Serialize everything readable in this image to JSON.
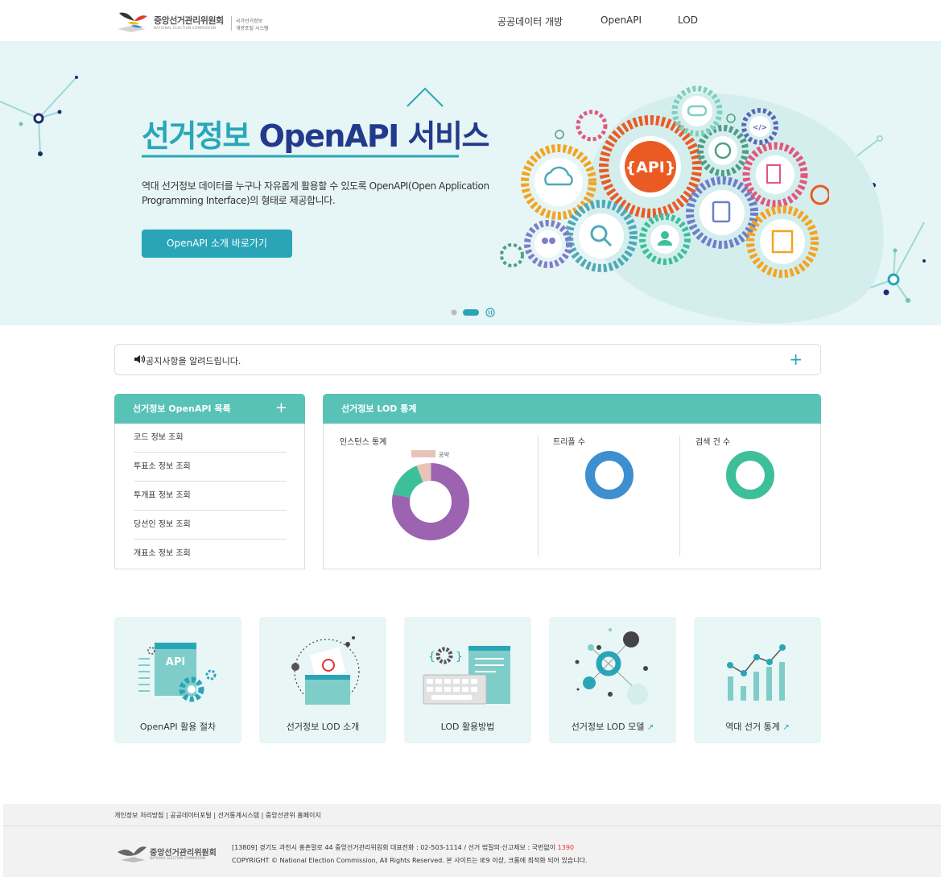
{
  "header": {
    "org_name_kr": "중앙선거관리위원회",
    "org_name_en": "NATIONAL ELECTION COMMISSION",
    "portal_line1": "국가선거정보",
    "portal_line2": "개방포털 시스템",
    "nav": [
      {
        "label": "공공데이터 개방"
      },
      {
        "label": "OpenAPI"
      },
      {
        "label": "LOD"
      }
    ]
  },
  "hero": {
    "title_part1": "선거정보 ",
    "title_part2": "OpenAPI",
    "title_part3": " 서비스",
    "description": "역대 선거정보 데이터를 누구나 자유롭게 활용할 수 있도록 OpenAPI(Open Application Programming Interface)의 형태로 제공합니다.",
    "button_label": "OpenAPI 소개 바로가기",
    "api_badge": "{API}",
    "slides_total": 2,
    "slides_active": 2
  },
  "notice": {
    "text": "공지사항을 알려드립니다.",
    "plus": "+"
  },
  "api_list": {
    "title": "선거정보 OpenAPI 목록",
    "plus": "+",
    "items": [
      {
        "label": "코드 정보 조회"
      },
      {
        "label": "투표소 정보 조회"
      },
      {
        "label": "투개표 정보 조회"
      },
      {
        "label": "당선인 정보 조회"
      },
      {
        "label": "개표소 정보 조회"
      }
    ]
  },
  "lod_stats": {
    "title": "선거정보 LOD 통계",
    "instance_label": "인스턴스 통계",
    "triple_label": "트리플 수",
    "search_label": "검색 건 수",
    "legend_label": "공약"
  },
  "chart_data": [
    {
      "type": "pie",
      "donut": true,
      "title": "인스턴스 통계",
      "slices": [
        {
          "name": "",
          "value": 0.78,
          "color": "#9b63b0"
        },
        {
          "name": "",
          "value": 0.16,
          "color": "#3dbf9a"
        },
        {
          "name": "공약",
          "value": 0.06,
          "color": "#e8c3b8"
        }
      ],
      "legend": [
        "공약"
      ]
    },
    {
      "type": "pie",
      "donut": true,
      "title": "트리플 수",
      "slices": [
        {
          "name": "",
          "value": 1.0,
          "color": "#3d8fd0"
        }
      ]
    },
    {
      "type": "pie",
      "donut": true,
      "title": "검색 건 수",
      "slices": [
        {
          "name": "",
          "value": 1.0,
          "color": "#3dbf9a"
        }
      ]
    }
  ],
  "cards": [
    {
      "label": "OpenAPI 활용 절차",
      "external": false
    },
    {
      "label": "선거정보 LOD 소개",
      "external": false
    },
    {
      "label": "LOD 활용방법",
      "external": false
    },
    {
      "label": "선거정보 LOD 모델",
      "external": true
    },
    {
      "label": "역대 선거 통계",
      "external": true
    }
  ],
  "footer": {
    "links": [
      {
        "label": "개인정보 처리방침"
      },
      {
        "label": "공공데이터포털"
      },
      {
        "label": "선거통계시스템"
      },
      {
        "label": "중앙선관위 홈페이지"
      }
    ],
    "org_name_kr": "중앙선거관리위원회",
    "org_name_en": "NATIONAL ELECTION COMMISSION",
    "address": "[13809] 경기도 과천시 홍촌말로 44 중앙선거관리위원회    대표전화 : 02-503-1114 / 선거 법질의·신고제보 : 국번없이 ",
    "hotline": "1390",
    "copyright": "COPYRIGHT © National Election Commission, All Rights Reserved. 본 사이트는 IE9 이상, 크롬에 최적화 되어 있습니다."
  },
  "colors": {
    "accent": "#2aa5b8",
    "navy": "#233a8c",
    "panel_header": "#58c2b7",
    "card_bg": "#e9f6f6",
    "hero_bg": "#e6f5f5"
  }
}
